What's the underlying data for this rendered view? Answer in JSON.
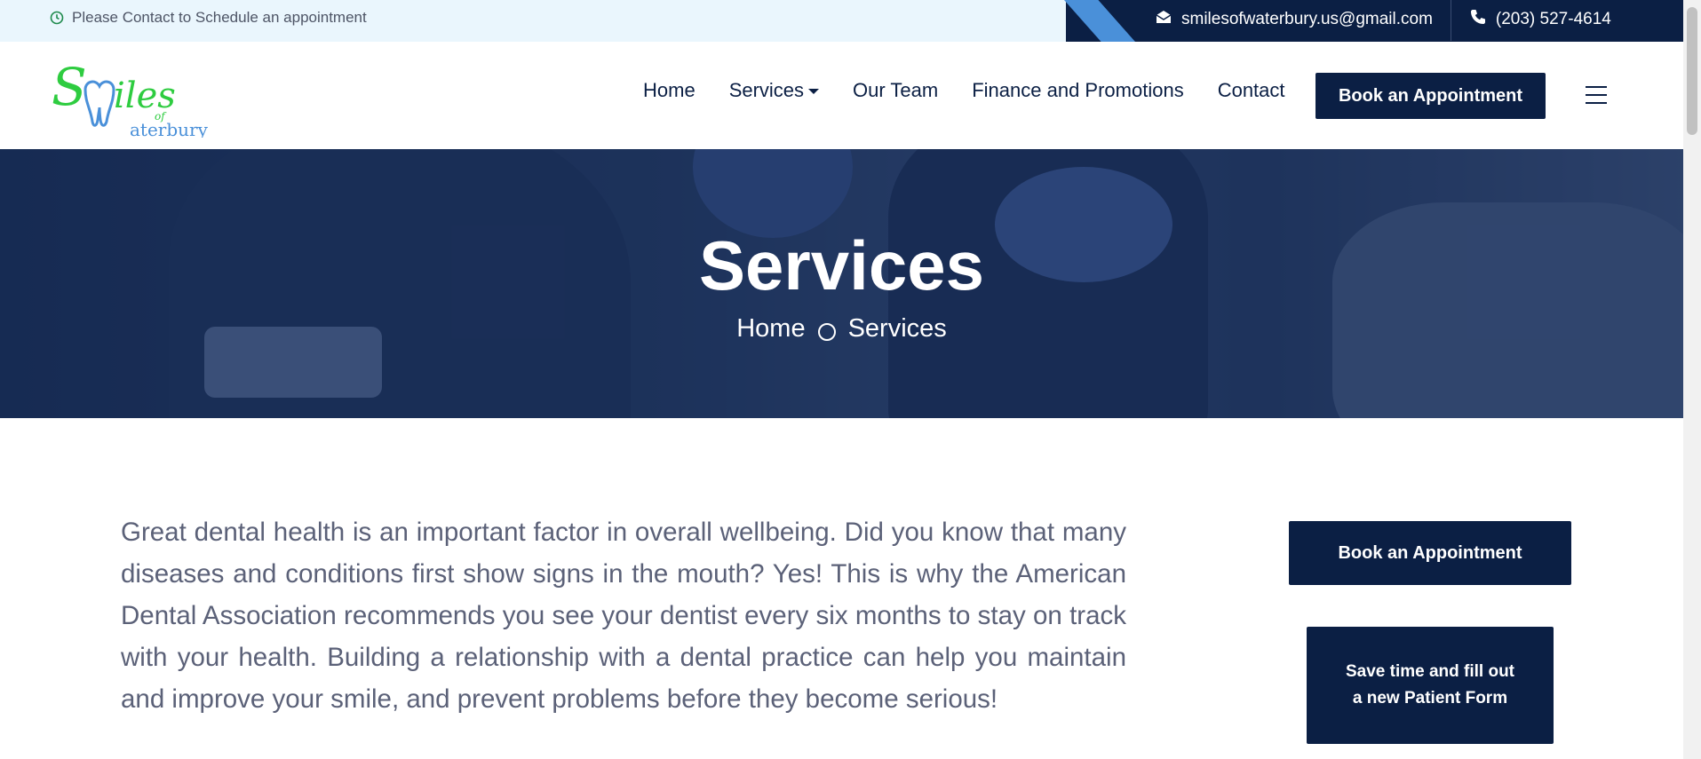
{
  "topbar": {
    "notice": "Please Contact to Schedule an appointment",
    "email": "smilesofwaterbury.us@gmail.com",
    "phone": "(203) 527-4614"
  },
  "logo": {
    "alt": "Smiles of Waterbury"
  },
  "nav": {
    "items": [
      {
        "label": "Home"
      },
      {
        "label": "Services"
      },
      {
        "label": "Our Team"
      },
      {
        "label": "Finance and Promotions"
      },
      {
        "label": "Contact"
      }
    ],
    "cta": "Book an Appointment"
  },
  "hero": {
    "title": "Services",
    "breadcrumb": [
      "Home",
      "Services"
    ]
  },
  "content": {
    "paragraph": "Great dental health is an important factor in overall wellbeing. Did you know that many diseases and conditions first show signs in the mouth? Yes! This is why the American Dental Association recommends you see your dentist every six months to stay on track with your health. Building a relationship with a dental practice can help you maintain and improve your smile, and prevent problems before they become serious!"
  },
  "sidebar": {
    "book_button": "Book an Appointment",
    "form_button": "Save time and fill out a new Patient Form"
  },
  "colors": {
    "navy": "#0b1f44",
    "accent_blue": "#4a90d9",
    "logo_green": "#2ecc40",
    "logo_blue": "#4a90d9"
  }
}
